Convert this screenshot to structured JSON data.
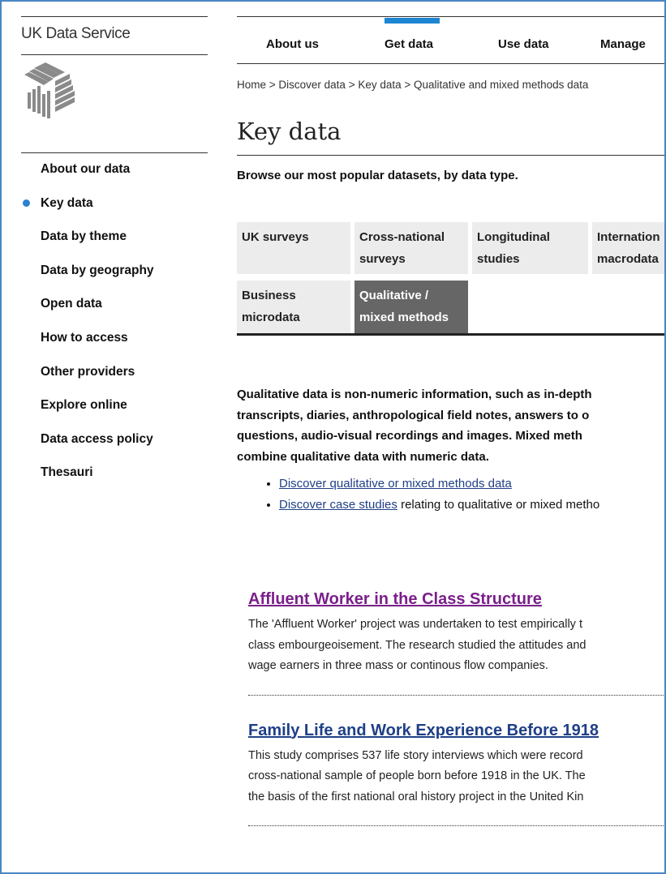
{
  "brand": "UK Data Service",
  "colors": {
    "accent": "#1d86d3",
    "visited_link": "#7a1f8a",
    "link": "#1f3f87",
    "active_tab": "#666666",
    "tab_bg": "#ececec",
    "frame_border": "#4a86c5"
  },
  "sidebar": {
    "items": [
      {
        "label": "About our data",
        "active": false
      },
      {
        "label": "Key data",
        "active": true
      },
      {
        "label": "Data by theme",
        "active": false
      },
      {
        "label": "Data by geography",
        "active": false
      },
      {
        "label": "Open data",
        "active": false
      },
      {
        "label": "How to access",
        "active": false
      },
      {
        "label": "Other providers",
        "active": false
      },
      {
        "label": "Explore online",
        "active": false
      },
      {
        "label": "Data access policy",
        "active": false
      },
      {
        "label": "Thesauri",
        "active": false
      }
    ]
  },
  "topnav": {
    "items": [
      {
        "label": "About us"
      },
      {
        "label": "Get data",
        "active": true
      },
      {
        "label": "Use data"
      },
      {
        "label": "Manage"
      }
    ]
  },
  "breadcrumb": {
    "items": [
      "Home",
      "Discover data",
      "Key data",
      "Qualitative and mixed methods data"
    ],
    "separator": " > "
  },
  "page": {
    "title": "Key data",
    "intro": "Browse our most popular datasets, by data type."
  },
  "tabs": [
    {
      "line1": "UK surveys",
      "line2": "",
      "active": false
    },
    {
      "line1": "Cross-national",
      "line2": "surveys",
      "active": false
    },
    {
      "line1": "Longitudinal",
      "line2": "studies",
      "active": false
    },
    {
      "line1": "Internation",
      "line2": "macrodata",
      "active": false
    },
    {
      "line1": "Business",
      "line2": "microdata",
      "active": false
    },
    {
      "line1": "Qualitative /",
      "line2": "mixed methods",
      "active": true
    }
  ],
  "description": {
    "lines": [
      "Qualitative data is non-numeric information, such as in-depth",
      "transcripts, diaries, anthropological field notes, answers to o",
      "questions, audio-visual recordings and images.  Mixed meth",
      "combine qualitative data with numeric data."
    ]
  },
  "links": [
    {
      "link_text": "Discover qualitative or mixed methods data",
      "rest": ""
    },
    {
      "link_text": "Discover case studies",
      "rest": " relating to qualitative or mixed metho"
    }
  ],
  "studies": [
    {
      "title": "Affluent Worker in the Class Structure",
      "visited": true,
      "lines": [
        "The 'Affluent Worker' project was undertaken to test empirically t",
        "class embourgeoisement. The research studied the attitudes and",
        "wage earners in three mass or continous flow companies."
      ]
    },
    {
      "title": "Family Life and Work Experience Before 1918",
      "visited": false,
      "lines": [
        "This study comprises 537 life story interviews which were record",
        "cross-national sample of people born before 1918 in the UK. The",
        "the basis of the first national oral history project in the United Kin"
      ]
    }
  ]
}
